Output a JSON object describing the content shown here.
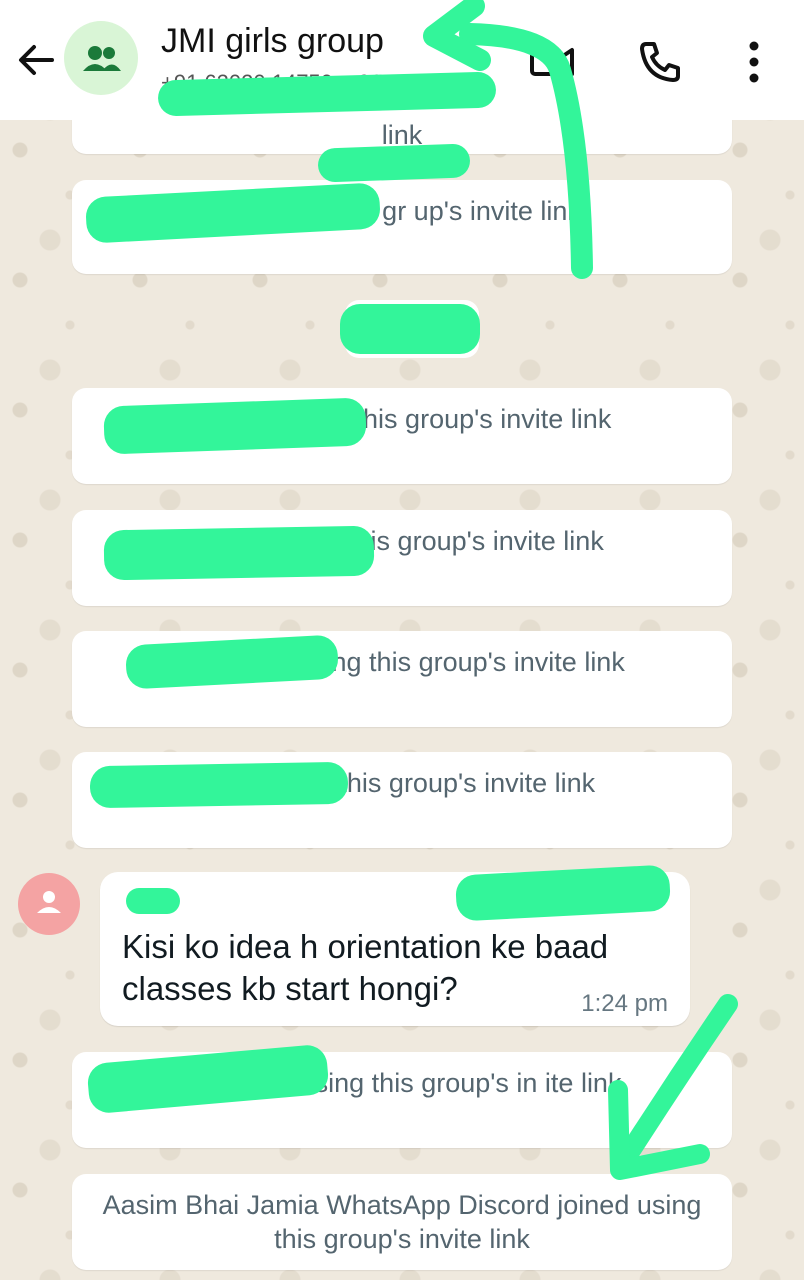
{
  "header": {
    "title": "JMI girls group",
    "subtitle": "+91 62020 14750, +91 D",
    "icons": {
      "back": "arrow-left-icon",
      "avatar": "group-icon",
      "video": "video-call-icon",
      "call": "phone-icon",
      "menu": "more-vert-icon"
    }
  },
  "system_messages": [
    {
      "text": "link"
    },
    {
      "text": "ed using this gr up's invite link"
    },
    {
      "text": "+9 ned using this group's invite link"
    },
    {
      "text": "+9 ed using this group's invite link"
    },
    {
      "text": "+9 joined using this group's invite link"
    },
    {
      "text": "ined using this group's invite link"
    },
    {
      "text": "12 joined using this group's in ite link"
    },
    {
      "text": "Aasim Bhai Jamia WhatsApp Discord joined using this group's invite link"
    }
  ],
  "incoming_message": {
    "sender_phone": "+9",
    "text": "Kisi ko idea h orientation ke baad classes kb start hongi?",
    "time": "1:24 pm"
  },
  "colors": {
    "header_bg": "#ffffff",
    "avatar_bg": "#d9f5d6",
    "avatar_icon": "#1b7a3a",
    "system_text": "#54656f",
    "highlighter": "#33f59a",
    "sender_avatar": "#f4a3a3"
  }
}
